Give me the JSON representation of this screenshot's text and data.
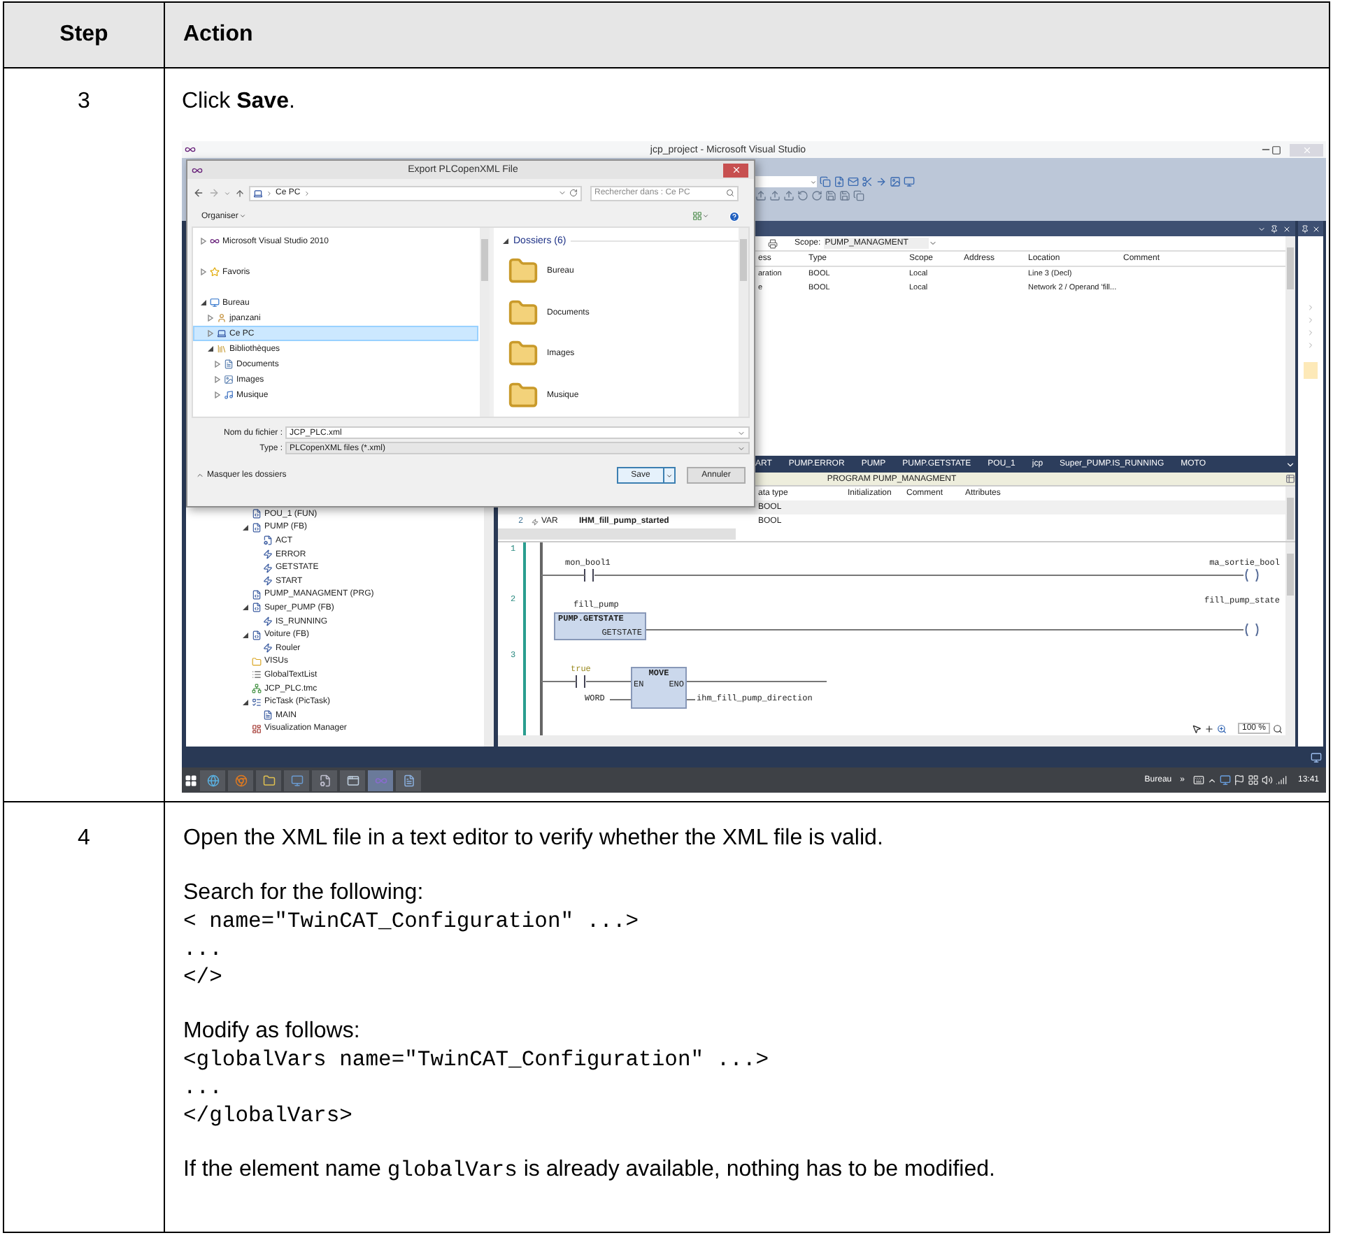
{
  "table": {
    "columns": [
      "Step",
      "Action"
    ],
    "rows": [
      {
        "step": "3",
        "instruction": "Click **Save**.",
        "screenshot": {
          "ide": {
            "title": "jcp_project - Microsoft Visual Studio",
            "find_panel": {
              "scope_label": "Scope:",
              "scope_value": "PUMP_MANAGMENT",
              "columns": [
                "ess",
                "Type",
                "Scope",
                "Address",
                "Location",
                "Comment"
              ],
              "rows": [
                {
                  "column_1": "aration",
                  "type": "BOOL",
                  "scope": "Local",
                  "location": "Line 3 (Decl)"
                },
                {
                  "column_1": "e",
                  "type": "BOOL",
                  "scope": "Local",
                  "location": "Network 2 / Operand 'fill..."
                }
              ]
            },
            "solution_tree": [
              {
                "label": "POU_1 (FUN)",
                "kind": "pou"
              },
              {
                "label": "PUMP (FB)",
                "kind": "pou",
                "expanded": true,
                "children": [
                  {
                    "label": "ACT",
                    "kind": "action"
                  },
                  {
                    "label": "ERROR",
                    "kind": "method"
                  },
                  {
                    "label": "GETSTATE",
                    "kind": "method"
                  },
                  {
                    "label": "START",
                    "kind": "method"
                  }
                ]
              },
              {
                "label": "PUMP_MANAGMENT (PRG)",
                "kind": "pou"
              },
              {
                "label": "Super_PUMP (FB)",
                "kind": "pou",
                "expanded": true,
                "children": [
                  {
                    "label": "IS_RUNNING",
                    "kind": "method"
                  }
                ]
              },
              {
                "label": "Voiture (FB)",
                "kind": "pou",
                "expanded": true,
                "children": [
                  {
                    "label": "Rouler",
                    "kind": "method"
                  }
                ]
              },
              {
                "label": "VISUs",
                "kind": "folder"
              },
              {
                "label": "GlobalTextList",
                "kind": "list"
              },
              {
                "label": "JCP_PLC.tmc",
                "kind": "tmc"
              },
              {
                "label": "PicTask (PicTask)",
                "kind": "task",
                "expanded": true,
                "children": [
                  {
                    "label": "MAIN",
                    "kind": "program"
                  }
                ]
              },
              {
                "label": "Visualization Manager",
                "kind": "visu"
              }
            ],
            "editor_tabs": [
              "ART",
              "PUMP.ERROR",
              "PUMP",
              "PUMP.GETSTATE",
              "POU_1",
              "jcp",
              "Super_PUMP.IS_RUNNING",
              "MOTO"
            ],
            "editor": {
              "header": "PROGRAM PUMP_MANAGMENT",
              "var_columns": [
                "ata type",
                "Initialization",
                "Comment",
                "Attributes"
              ],
              "var_rows": [
                {
                  "data_type": "BOOL"
                },
                {
                  "number": "2",
                  "scope": "VAR",
                  "name": "IHM_fill_pump_started",
                  "data_type": "BOOL"
                }
              ],
              "networks": [
                {
                  "number": "1",
                  "contact": "mon_bool1",
                  "coil": "ma_sortie_bool"
                },
                {
                  "number": "2",
                  "block": {
                    "instance": "fill_pump",
                    "type": "PUMP.GETSTATE",
                    "output": "GETSTATE"
                  },
                  "coil": "fill_pump_state"
                },
                {
                  "number": "3",
                  "contact": "true",
                  "move": {
                    "title": "MOVE",
                    "en": "EN",
                    "eno": "ENO",
                    "input": "WORD",
                    "output": "ihm_fill_pump_direction"
                  }
                }
              ],
              "zoom": "100 %"
            }
          },
          "dialog": {
            "title": "Export PLCopenXML File",
            "breadcrumb": "Ce PC",
            "search_placeholder": "Rechercher dans : Ce PC",
            "organize": "Organiser",
            "nav": [
              {
                "label": "Microsoft Visual Studio 2010",
                "kind": "vs",
                "expanded": false,
                "selected": false
              },
              {
                "label": "Favoris",
                "kind": "star",
                "expanded": false,
                "selected": false
              },
              {
                "label": "Bureau",
                "kind": "desktop",
                "expanded": true,
                "selected": false,
                "children": [
                  {
                    "label": "jpanzani",
                    "kind": "user",
                    "expanded": false,
                    "selected": false
                  },
                  {
                    "label": "Ce PC",
                    "kind": "pc",
                    "expanded": false,
                    "selected": true
                  },
                  {
                    "label": "Bibliothèques",
                    "kind": "library",
                    "expanded": true,
                    "selected": false,
                    "children": [
                      {
                        "label": "Documents",
                        "kind": "documents",
                        "expanded": false,
                        "selected": false
                      },
                      {
                        "label": "Images",
                        "kind": "images",
                        "expanded": false,
                        "selected": false
                      },
                      {
                        "label": "Musique",
                        "kind": "music",
                        "expanded": false,
                        "selected": false
                      }
                    ]
                  }
                ]
              }
            ],
            "group": "Dossiers (6)",
            "folders": [
              "Bureau",
              "Documents",
              "Images",
              "Musique"
            ],
            "file_name_label": "Nom du fichier :",
            "file_name": "JCP_PLC.xml",
            "type_label": "Type :",
            "type_value": "PLCopenXML files (*.xml)",
            "hide_folders": "Masquer les dossiers",
            "buttons": [
              "Save",
              "Annuler"
            ]
          },
          "taskbar": {
            "tray_label": "Bureau",
            "chevron": "»",
            "time": "13:41"
          }
        }
      },
      {
        "step": "4",
        "blocks": [
          {
            "kind": "text",
            "text": "Open the XML file in a text editor to verify whether the XML file is valid."
          },
          {
            "kind": "text",
            "text": "Search for the following:"
          },
          {
            "kind": "code",
            "lines": [
              "< name=\"TwinCAT_Configuration\" ...>",
              "...",
              "</>"
            ]
          },
          {
            "kind": "text",
            "text": "Modify as follows:"
          },
          {
            "kind": "code",
            "lines": [
              "<globalVars name=\"TwinCAT_Configuration\" ...>",
              "...",
              "</globalVars>"
            ]
          },
          {
            "kind": "mixed",
            "before": "If the element name",
            "code": "globalVars",
            "after": "is already available, nothing has to be modified."
          }
        ]
      }
    ]
  }
}
